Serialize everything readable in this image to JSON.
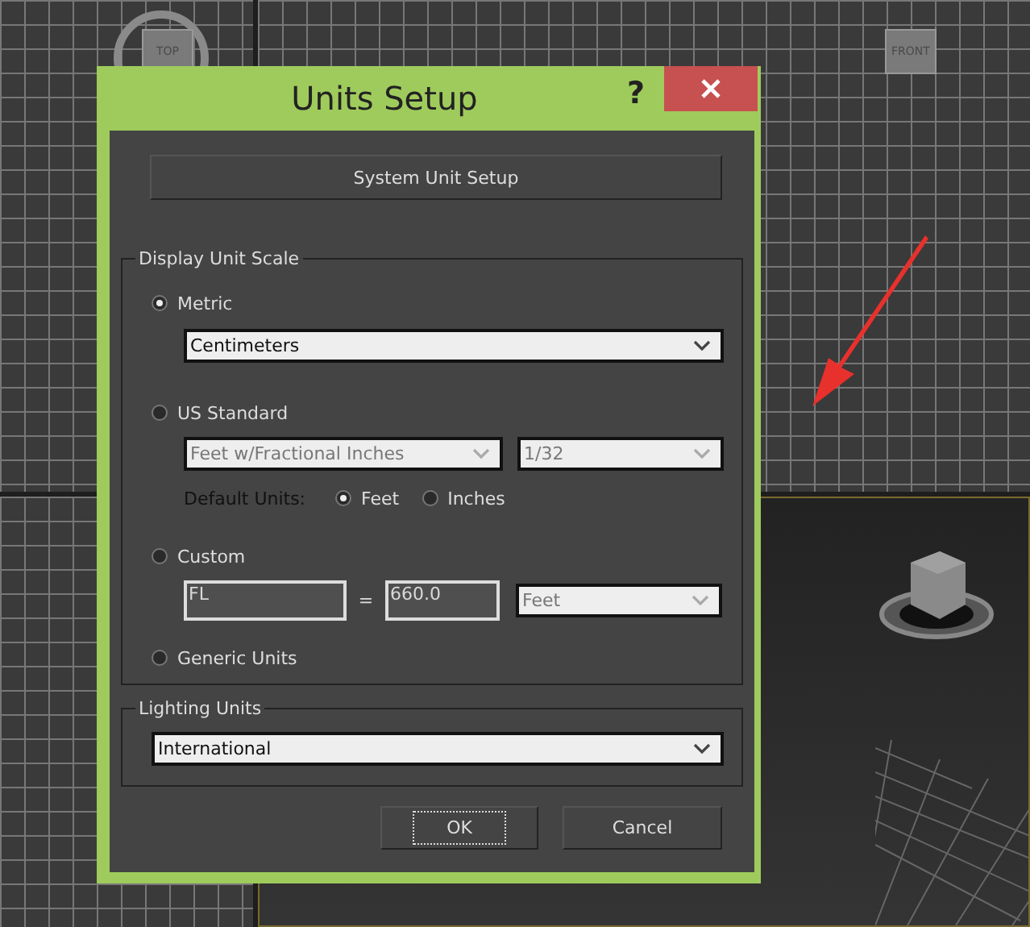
{
  "viewports": [
    {
      "kind": "grid",
      "label": "TOP"
    },
    {
      "kind": "grid",
      "label": "FRONT"
    },
    {
      "kind": "grid"
    },
    {
      "kind": "perspective"
    }
  ],
  "dialog": {
    "title": "Units Setup",
    "help": "?",
    "system_button": "System Unit Setup",
    "display_group": {
      "title": "Display Unit Scale",
      "metric": {
        "label": "Metric",
        "selected": true,
        "dropdown": {
          "value": "Centimeters",
          "disabled": false
        }
      },
      "us_standard": {
        "label": "US Standard",
        "selected": false,
        "dropdowns": [
          {
            "value": "Feet w/Fractional Inches",
            "disabled": true
          },
          {
            "value": "1/32",
            "disabled": true
          }
        ],
        "default_units_label": "Default Units:",
        "default_units": [
          {
            "label": "Feet",
            "selected": true
          },
          {
            "label": "Inches",
            "selected": false
          }
        ]
      },
      "custom": {
        "label": "Custom",
        "selected": false,
        "name_field": {
          "value": "FL",
          "disabled": true
        },
        "equals": "=",
        "amount_field": {
          "value": "660.0",
          "disabled": true
        },
        "dropdown": {
          "value": "Feet",
          "disabled": true
        }
      },
      "generic": {
        "label": "Generic Units",
        "selected": false
      }
    },
    "lighting_group": {
      "title": "Lighting Units",
      "dropdown": {
        "value": "International",
        "disabled": false
      }
    },
    "buttons": [
      {
        "label": "OK",
        "focused": true
      },
      {
        "label": "Cancel",
        "focused": false
      }
    ]
  }
}
